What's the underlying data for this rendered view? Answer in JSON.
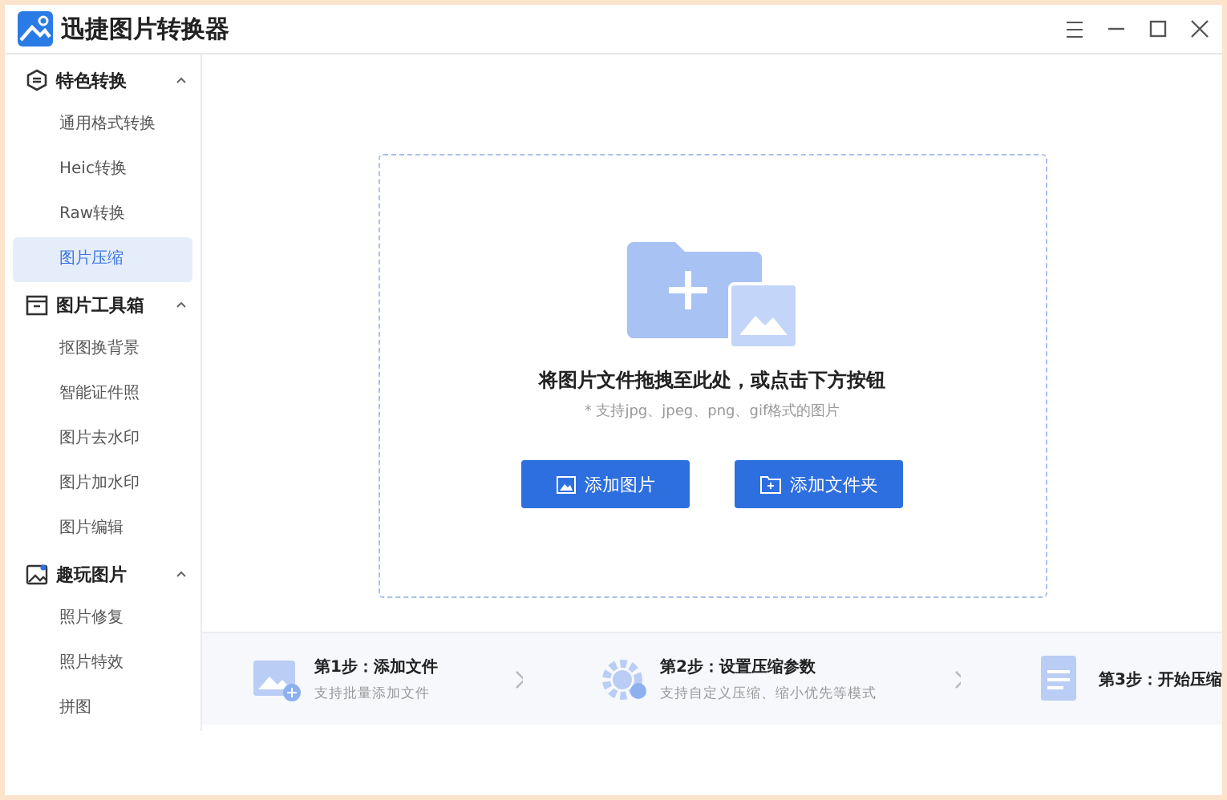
{
  "window": {
    "title": "迅捷图片转换器"
  },
  "sidebar": {
    "groups": [
      {
        "label": "特色转换",
        "kind": "convert",
        "expanded": true,
        "items": [
          {
            "label": "通用格式转换",
            "selected": false
          },
          {
            "label": "Heic转换",
            "selected": false
          },
          {
            "label": "Raw转换",
            "selected": false
          },
          {
            "label": "图片压缩",
            "selected": true
          }
        ]
      },
      {
        "label": "图片工具箱",
        "kind": "toolbox",
        "expanded": true,
        "items": [
          {
            "label": "抠图换背景",
            "selected": false
          },
          {
            "label": "智能证件照",
            "selected": false
          },
          {
            "label": "图片去水印",
            "selected": false
          },
          {
            "label": "图片加水印",
            "selected": false
          },
          {
            "label": "图片编辑",
            "selected": false
          }
        ]
      },
      {
        "label": "趣玩图片",
        "kind": "fun",
        "expanded": true,
        "items": [
          {
            "label": "照片修复",
            "selected": false
          },
          {
            "label": "照片特效",
            "selected": false
          },
          {
            "label": "拼图",
            "selected": false
          }
        ]
      }
    ]
  },
  "drop_zone": {
    "title": "将图片文件拖拽至此处，或点击下方按钮",
    "hint": "* 支持jpg、jpeg、png、gif格式的图片",
    "buttons": [
      {
        "label": "添加图片",
        "kind": "image"
      },
      {
        "label": "添加文件夹",
        "kind": "folder"
      }
    ]
  },
  "steps": [
    {
      "title": "第1步：添加文件",
      "subtitle": "支持批量添加文件",
      "kind": "add"
    },
    {
      "title": "第2步：设置压缩参数",
      "subtitle": "支持自定义压缩、缩小优先等模式",
      "kind": "settings"
    },
    {
      "title": "第3步：开始压缩",
      "kind": "start"
    }
  ]
}
